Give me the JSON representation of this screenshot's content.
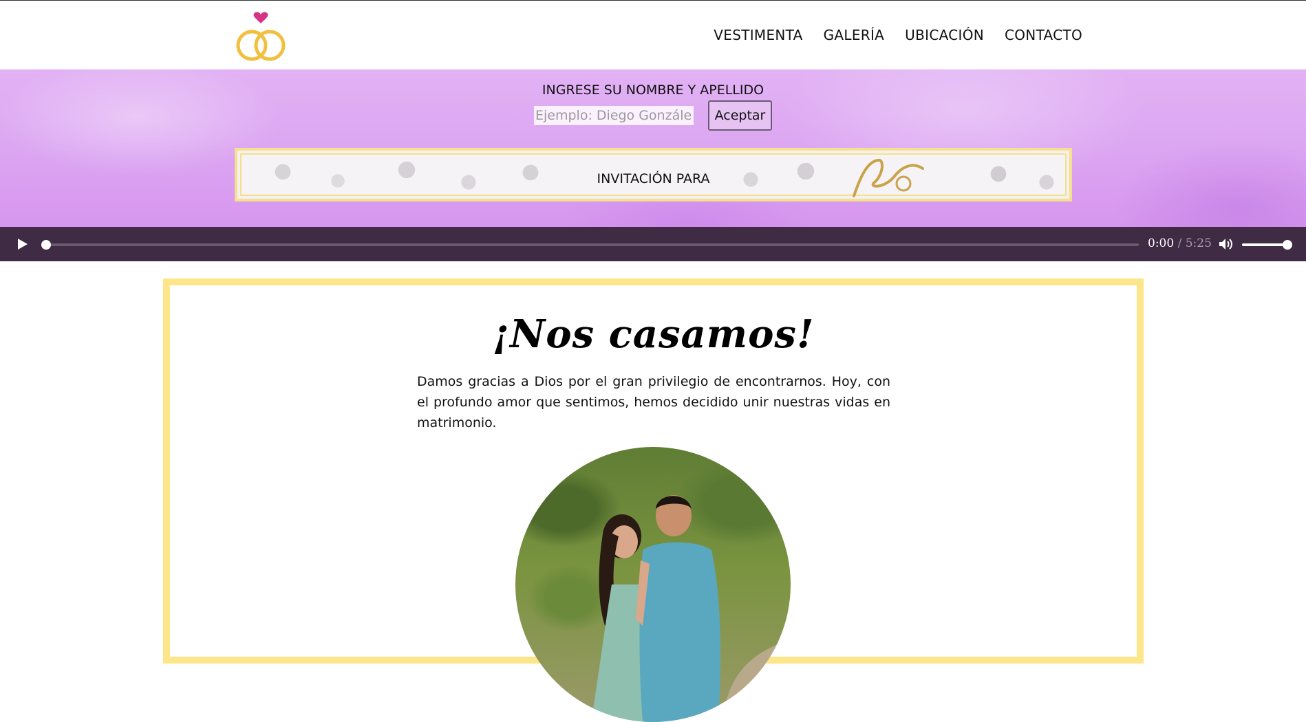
{
  "nav": {
    "items": [
      "VESTIMENTA",
      "GALERÍA",
      "UBICACIÓN",
      "CONTACTO"
    ]
  },
  "hero": {
    "prompt": "INGRESE SU NOMBRE Y APELLIDO",
    "input_placeholder": "Ejemplo: Diego González",
    "input_value": "",
    "accept_label": "Aceptar",
    "banner_text": "INVITACIÓN PARA"
  },
  "player": {
    "current_time": "0:00",
    "separator": " / ",
    "duration": "5:25",
    "progress": 0.0,
    "volume": 1.0
  },
  "card": {
    "title": "¡Nos casamos!",
    "text": "Damos gracias a Dios por el gran privilegio de encontrarnos. Hoy, con el profundo amor que sentimos, hemos decidido unir nuestras vidas en matrimonio."
  },
  "colors": {
    "hero_purple": "#dca6f2",
    "player_bg": "#402b45",
    "card_border": "#fde68a",
    "heart": "#d63384",
    "rings": "#f0c040"
  }
}
